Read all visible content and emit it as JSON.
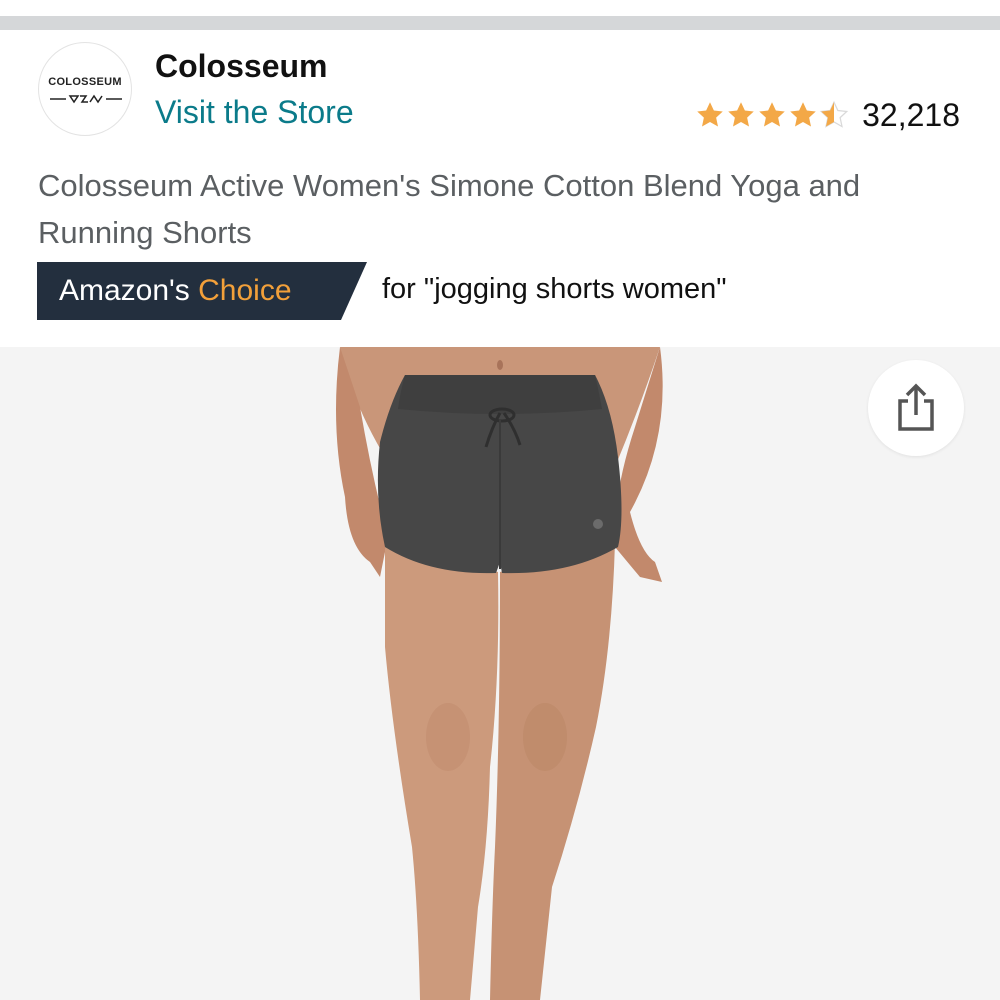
{
  "header": {
    "logo_text": "COLOSSEUM",
    "brand_name": "Colosseum",
    "visit_store_label": "Visit the Store"
  },
  "rating": {
    "stars": 4.5,
    "count": "32,218",
    "star_color": "#f3a847"
  },
  "product": {
    "title": "Colosseum Active Women's Simone Cotton Blend Yoga and Running Shorts"
  },
  "badge": {
    "prefix": "Amazon's",
    "accent": "Choice",
    "query": "for \"jogging shorts women\"",
    "background_color": "#232f3e",
    "accent_color": "#f2a03a"
  },
  "image": {
    "description_icon": "product-photo",
    "share_icon": "share-icon"
  },
  "colors": {
    "link": "#0b7b8a",
    "title_text": "#5b5f62",
    "image_background": "#f4f4f4"
  }
}
